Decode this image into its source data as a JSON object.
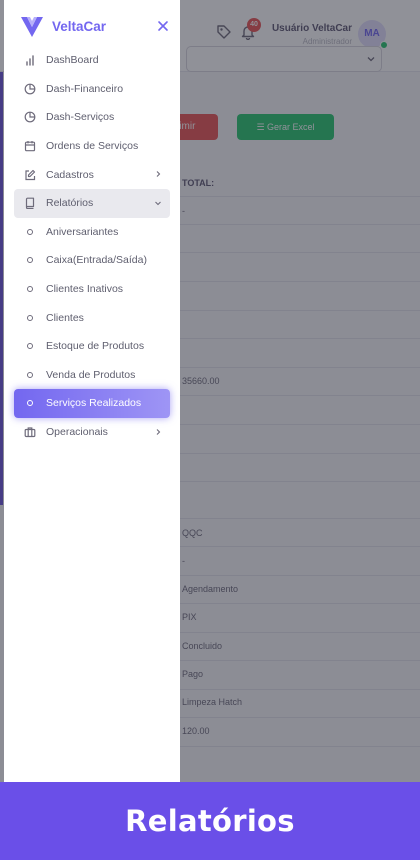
{
  "header": {
    "notification_count": "40",
    "user_name": "Usuário VeltaCar",
    "user_role": "Administrador",
    "avatar_initials": "MA"
  },
  "toolbar": {
    "print_label": "rimir",
    "excel_label": "☰ Gerar Excel"
  },
  "table": {
    "total_header": "TOTAL:",
    "cells": [
      "-",
      "35660.00",
      "QQC",
      "-",
      "Agendamento",
      "PIX",
      "Concluido",
      "Pago",
      "Limpeza Hatch",
      "120.00"
    ]
  },
  "sidebar": {
    "brand": "VeltaCar",
    "items": [
      {
        "label": "DashBoard",
        "icon": "bar-chart-icon"
      },
      {
        "label": "Dash-Financeiro",
        "icon": "pie-chart-icon"
      },
      {
        "label": "Dash-Serviços",
        "icon": "pie-chart-icon"
      },
      {
        "label": "Ordens de Serviços",
        "icon": "calendar-icon"
      },
      {
        "label": "Cadastros",
        "icon": "edit-icon"
      },
      {
        "label": "Relatórios",
        "icon": "book-icon"
      },
      {
        "label": "Aniversariantes",
        "icon": "circle-icon"
      },
      {
        "label": "Caixa(Entrada/Saída)",
        "icon": "circle-icon"
      },
      {
        "label": "Clientes Inativos",
        "icon": "circle-icon"
      },
      {
        "label": "Clientes",
        "icon": "circle-icon"
      },
      {
        "label": "Estoque de Produtos",
        "icon": "circle-icon"
      },
      {
        "label": "Venda de Produtos",
        "icon": "circle-icon"
      },
      {
        "label": "Serviços Realizados",
        "icon": "circle-icon"
      },
      {
        "label": "Operacionais",
        "icon": "briefcase-icon"
      }
    ]
  },
  "banner": {
    "title": "Relatórios"
  },
  "colors": {
    "primary": "#7367f0",
    "banner": "#6a4fe8",
    "danger": "#ea5455",
    "success": "#28c76f"
  }
}
